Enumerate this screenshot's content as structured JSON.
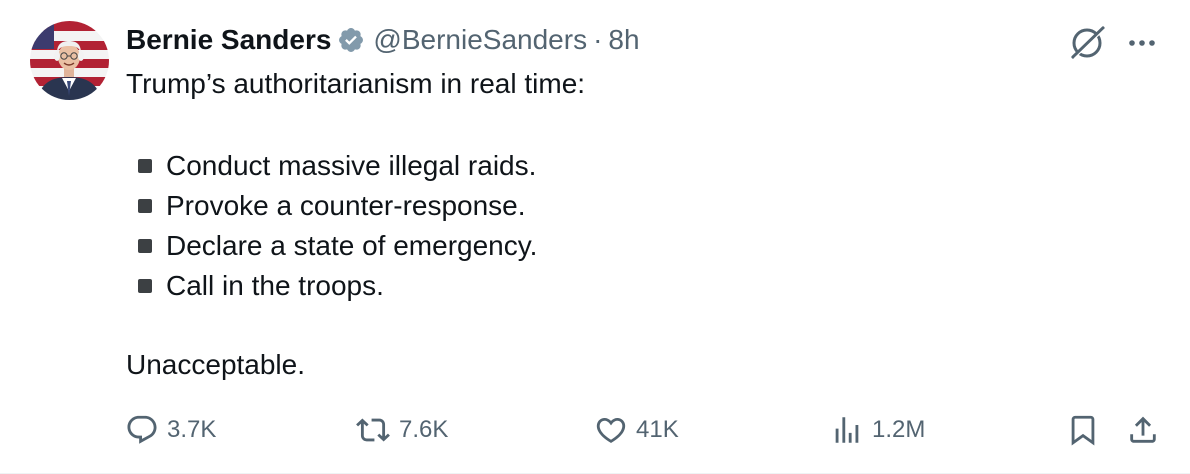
{
  "author": {
    "display_name": "Bernie Sanders",
    "handle": "@BernieSanders",
    "separator": "·",
    "time": "8h",
    "verified_icon": "verified-badge-icon"
  },
  "tweet": {
    "intro": "Trump’s authoritarianism in real time:",
    "bullets": [
      "Conduct massive illegal raids.",
      "Provoke a counter-response.",
      "Declare a state of emergency.",
      "Call in the troops."
    ],
    "closing": "Unacceptable."
  },
  "actions": {
    "replies": "3.7K",
    "reposts": "7.6K",
    "likes": "41K",
    "views": "1.2M"
  },
  "icons": {
    "grok": "grok-icon",
    "more": "more-icon",
    "reply": "reply-icon",
    "repost": "repost-icon",
    "like": "heart-icon",
    "views": "views-icon",
    "bookmark": "bookmark-icon",
    "share": "share-icon"
  },
  "colors": {
    "text": "#0f1419",
    "secondary": "#536471",
    "verified": "#829aab",
    "bullet": "#3c4043"
  }
}
